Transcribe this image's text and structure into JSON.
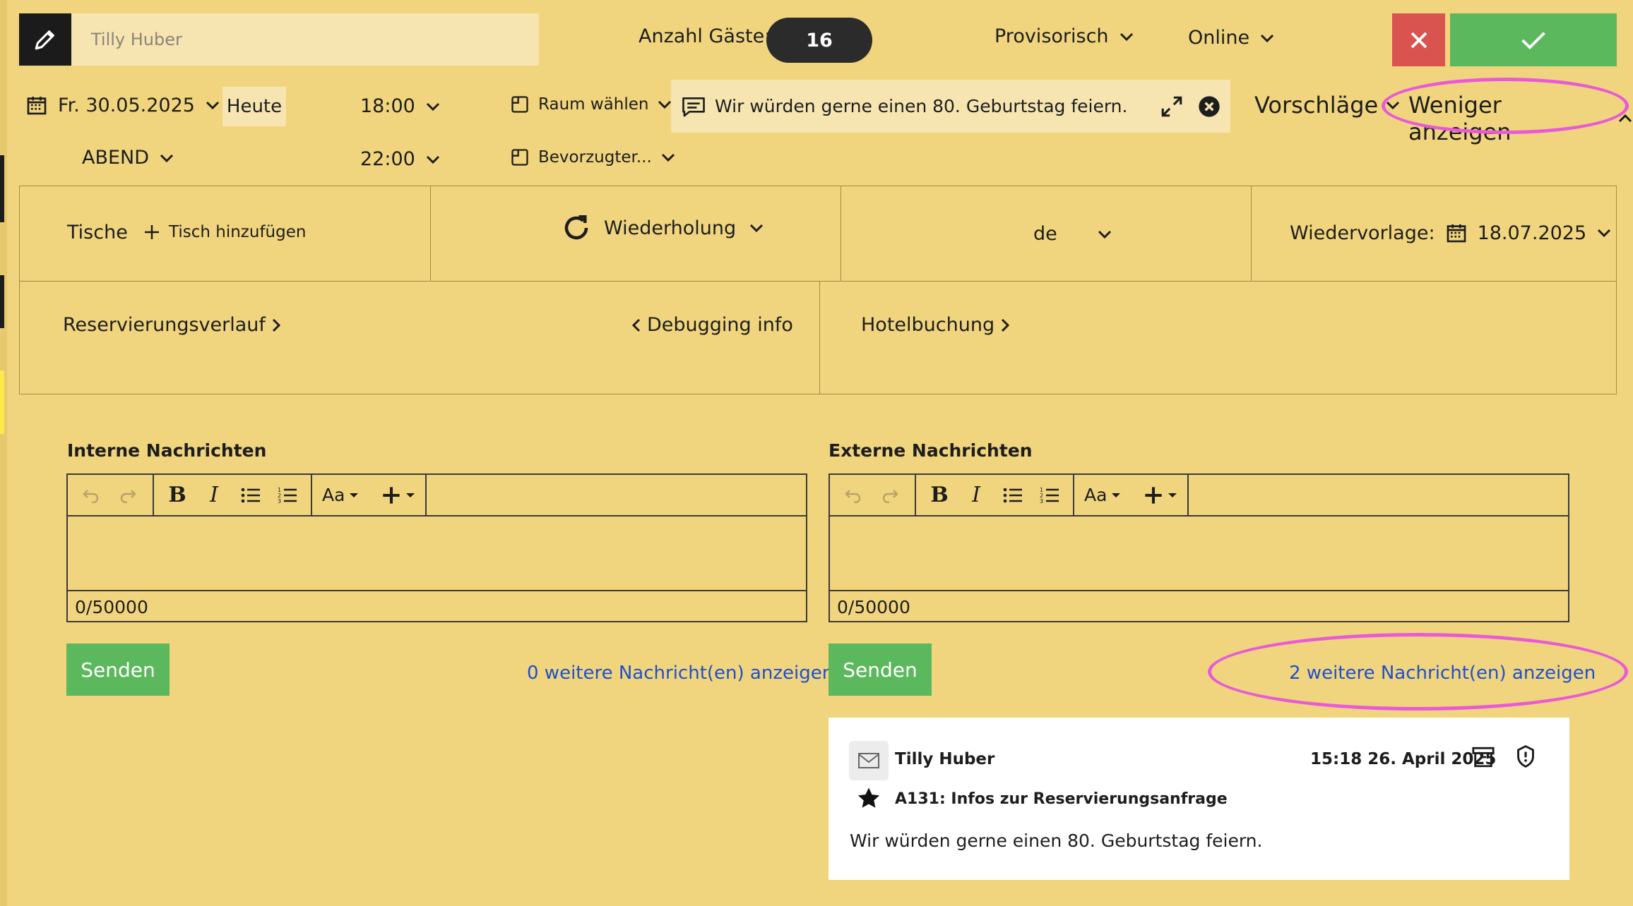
{
  "header": {
    "name_value": "Tilly Huber",
    "guests_label": "Anzahl Gäste:",
    "guests_value": "16",
    "status": "Provisorisch",
    "channel": "Online"
  },
  "date_row": {
    "date": "Fr. 30.05.2025",
    "today": "Heute",
    "time_start": "18:00",
    "time_end": "22:00",
    "shift": "ABEND",
    "room": "Raum wählen",
    "preferred": "Bevorzugter...",
    "message": "Wir würden gerne einen 80. Geburtstag feiern.",
    "suggestions": "Vorschläge",
    "less": "Weniger anzeigen"
  },
  "panels": {
    "tables": "Tische",
    "add_table": "Tisch hinzufügen",
    "repeat": "Wiederholung",
    "language": "de",
    "followup_label": "Wiedervorlage:",
    "followup_date": "18.07.2025",
    "history": "Reservierungsverlauf",
    "debug": "Debugging info",
    "hotel": "Hotelbuchung"
  },
  "internal": {
    "title": "Interne Nachrichten",
    "counter": "0/50000",
    "send": "Senden",
    "more": "0 weitere Nachricht(en) anzeigen"
  },
  "external": {
    "title": "Externe Nachrichten",
    "counter": "0/50000",
    "send": "Senden",
    "more": "2 weitere Nachricht(en) anzeigen"
  },
  "toolbar": {
    "font_label": "Aa"
  },
  "message_card": {
    "sender": "Tilly Huber",
    "timestamp": "15:18 26. April 2025",
    "subject": "A131: Infos zur Reservierungsanfrage",
    "body": "Wir würden gerne einen 80. Geburtstag feiern."
  },
  "colors": {
    "background": "#f0d57e",
    "input_bg": "#f6e5b1",
    "success": "#5cb85c",
    "danger": "#d9534f",
    "link": "#1f4fcc",
    "annotation": "#e85ad8"
  }
}
